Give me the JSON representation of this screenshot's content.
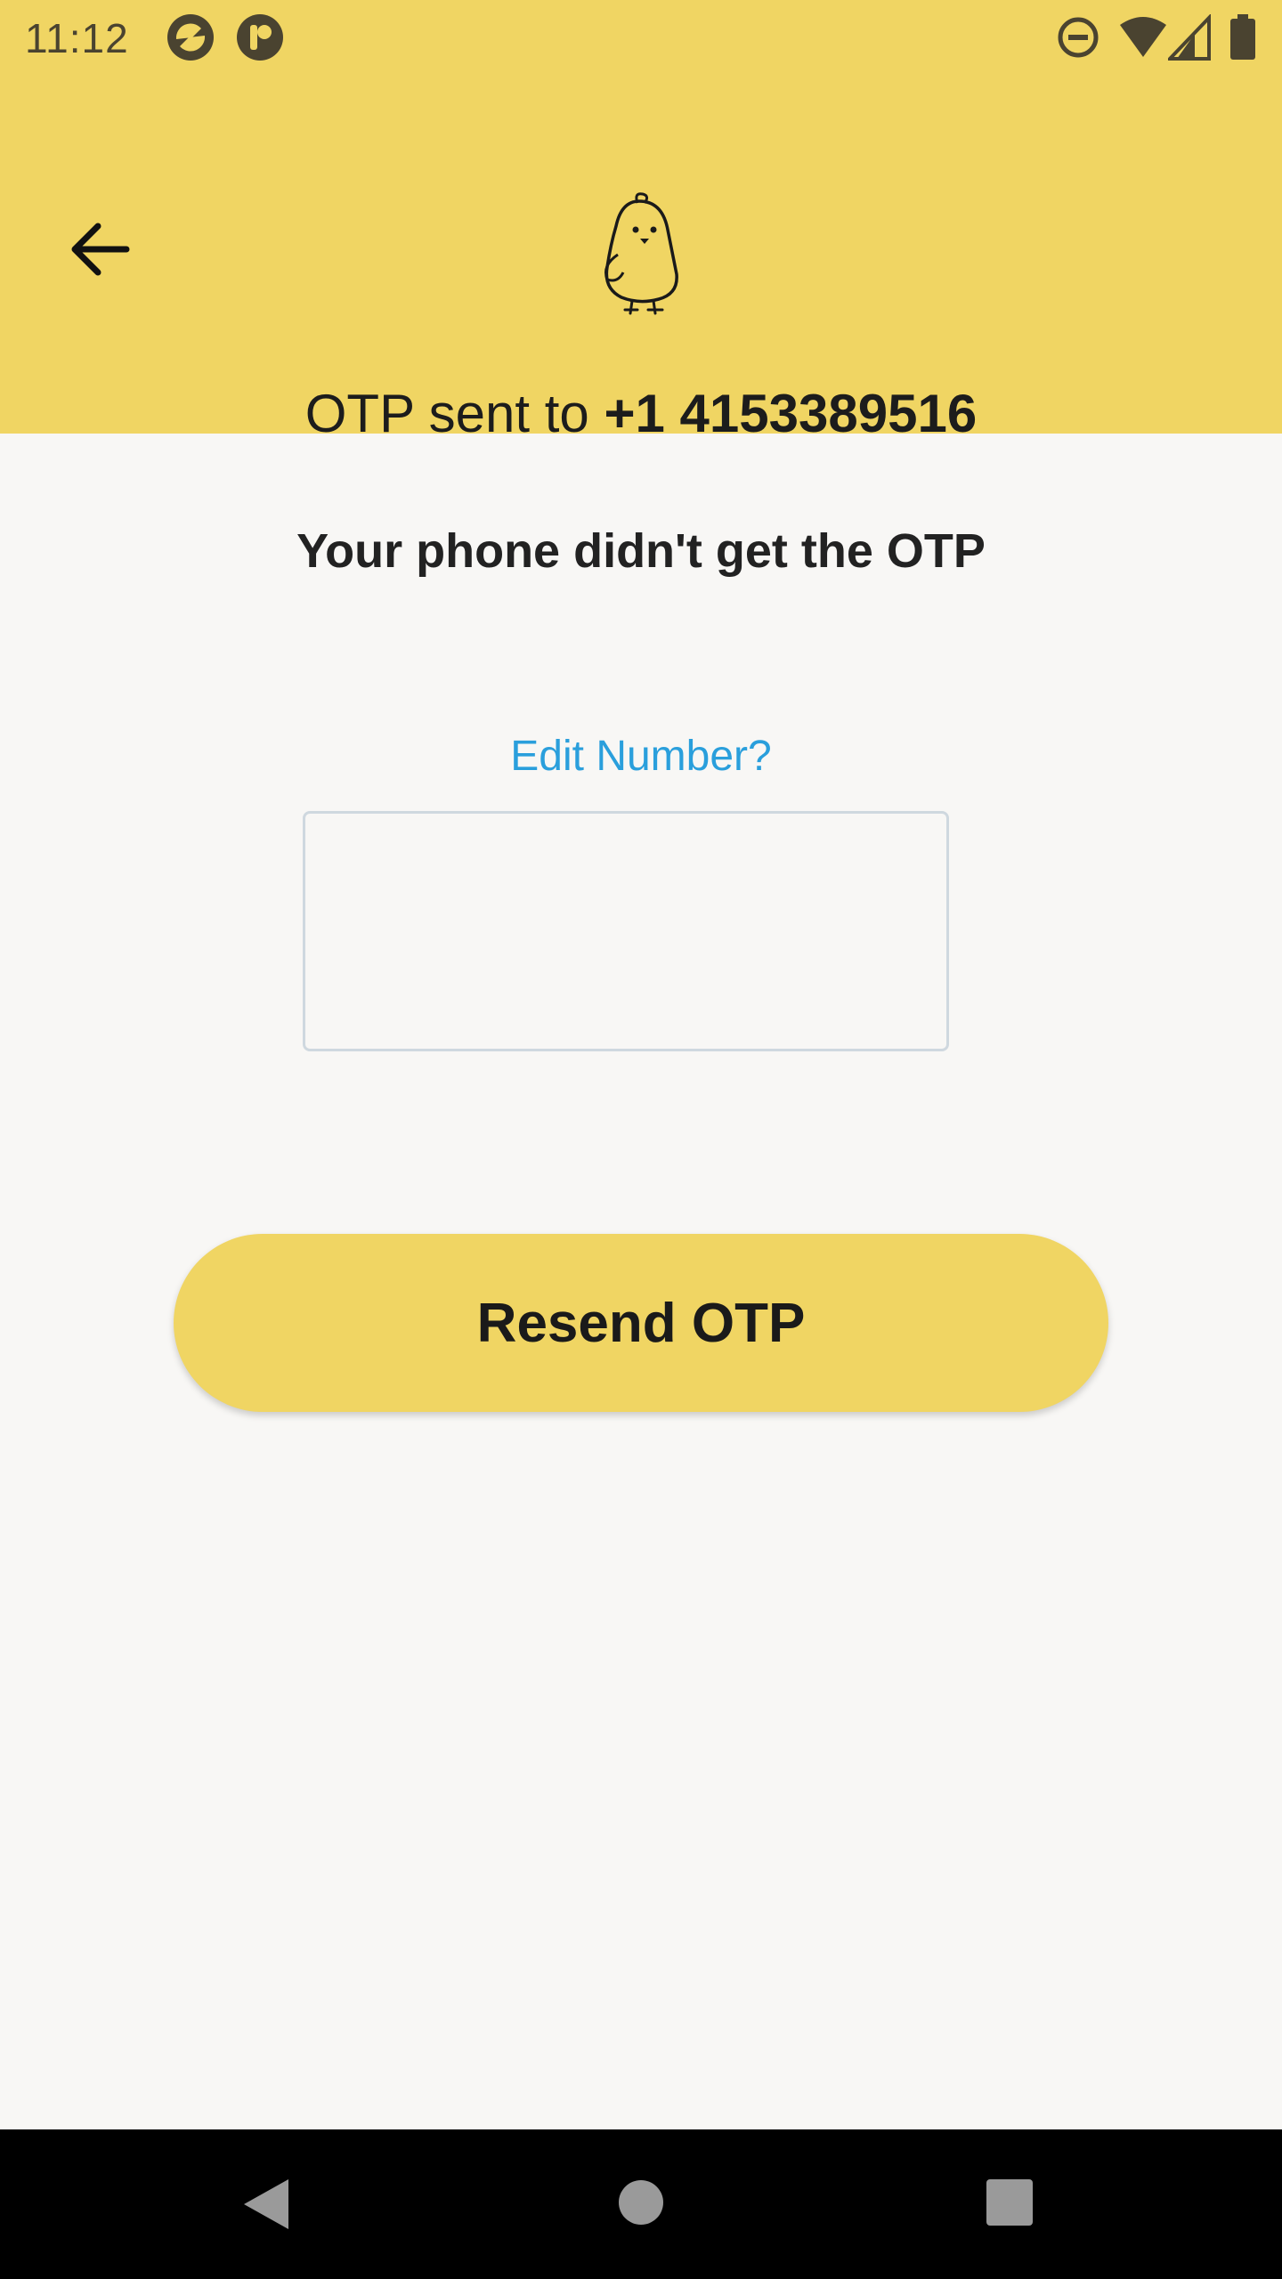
{
  "status_bar": {
    "time": "11:12",
    "icons": [
      "app-notification-icon-1",
      "app-notification-icon-2",
      "do-not-disturb-icon",
      "wifi-icon",
      "signal-icon",
      "battery-icon"
    ]
  },
  "header": {
    "back_icon": "arrow-left-icon",
    "logo": "chick-logo",
    "otp_prefix": "OTP sent to ",
    "phone_number": "+1 4153389516",
    "background_color": "#f0d563"
  },
  "main": {
    "headline": "Your phone didn't get the OTP",
    "edit_link": "Edit Number?",
    "otp_input_value": "",
    "resend_button": "Resend OTP",
    "link_color": "#2a9fdc",
    "button_color": "#f0d563"
  },
  "nav_bar": {
    "buttons": [
      "back-triangle-icon",
      "home-circle-icon",
      "recents-square-icon"
    ]
  }
}
